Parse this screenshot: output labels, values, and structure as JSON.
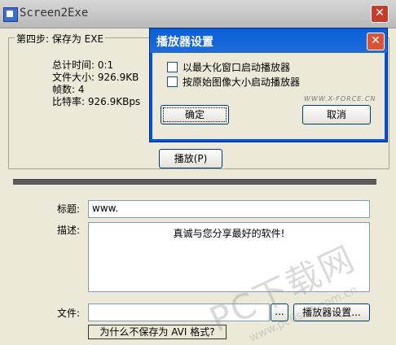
{
  "window": {
    "title": "Screen2Exe",
    "close_glyph": "✕"
  },
  "step": {
    "legend": "第四步: 保存为 EXE",
    "stats": {
      "total_time": "总计时间: 0:1",
      "file_size": "文件大小: 926.9KB",
      "frames": "帧数: 4",
      "bitrate": "比特率: 926.9KBps"
    },
    "play_label": "播放(P)"
  },
  "form": {
    "title_label": "标题:",
    "title_value": "www.",
    "desc_label": "描述:",
    "desc_value": "真诚与您分享最好的软件!",
    "file_label": "文件:",
    "file_value": "",
    "browse_label": "...",
    "player_settings_label": "播放器设置...",
    "why_avi_label": "为什么不保存为 AVI 格式?"
  },
  "dialog": {
    "title": "播放器设置",
    "close_glyph": "✕",
    "options": [
      {
        "label": "以最大化窗口启动播放器",
        "checked": false
      },
      {
        "label": "按原始图像大小启动播放器",
        "checked": false
      }
    ],
    "brand": "WWW.X-FORCE.CN",
    "ok_label": "确定",
    "cancel_label": "取消"
  },
  "watermark": {
    "text": "PC下载网",
    "url": "www.pc6soft.com.cn"
  }
}
